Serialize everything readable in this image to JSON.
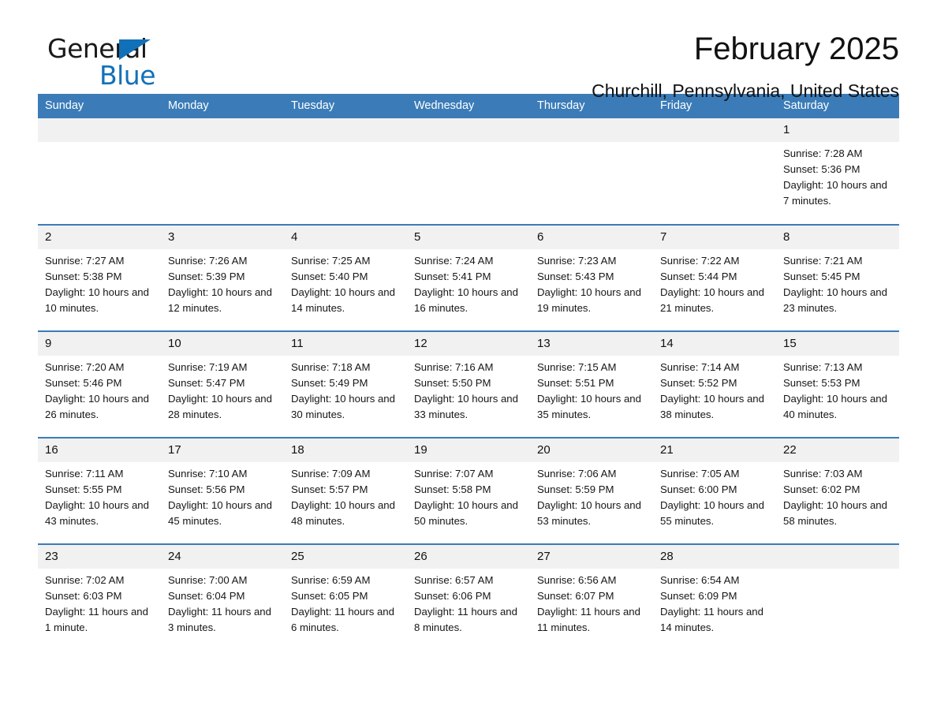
{
  "logo": {
    "text_top": "General",
    "text_bottom": "Blue",
    "triangle_icon": "triangle-icon",
    "accent_color": "#1171b8"
  },
  "header": {
    "title": "February 2025",
    "subtitle": "Churchill, Pennsylvania, United States"
  },
  "theme": {
    "header_blue": "#3b7cb8",
    "daynum_bg": "#f1f1f1",
    "text": "#161616"
  },
  "calendar": {
    "weekday_headers": [
      "Sunday",
      "Monday",
      "Tuesday",
      "Wednesday",
      "Thursday",
      "Friday",
      "Saturday"
    ],
    "weeks": [
      [
        {
          "day": "",
          "lines": []
        },
        {
          "day": "",
          "lines": []
        },
        {
          "day": "",
          "lines": []
        },
        {
          "day": "",
          "lines": []
        },
        {
          "day": "",
          "lines": []
        },
        {
          "day": "",
          "lines": []
        },
        {
          "day": "1",
          "lines": [
            "Sunrise: 7:28 AM",
            "Sunset: 5:36 PM",
            "Daylight: 10 hours and 7 minutes."
          ]
        }
      ],
      [
        {
          "day": "2",
          "lines": [
            "Sunrise: 7:27 AM",
            "Sunset: 5:38 PM",
            "Daylight: 10 hours and 10 minutes."
          ]
        },
        {
          "day": "3",
          "lines": [
            "Sunrise: 7:26 AM",
            "Sunset: 5:39 PM",
            "Daylight: 10 hours and 12 minutes."
          ]
        },
        {
          "day": "4",
          "lines": [
            "Sunrise: 7:25 AM",
            "Sunset: 5:40 PM",
            "Daylight: 10 hours and 14 minutes."
          ]
        },
        {
          "day": "5",
          "lines": [
            "Sunrise: 7:24 AM",
            "Sunset: 5:41 PM",
            "Daylight: 10 hours and 16 minutes."
          ]
        },
        {
          "day": "6",
          "lines": [
            "Sunrise: 7:23 AM",
            "Sunset: 5:43 PM",
            "Daylight: 10 hours and 19 minutes."
          ]
        },
        {
          "day": "7",
          "lines": [
            "Sunrise: 7:22 AM",
            "Sunset: 5:44 PM",
            "Daylight: 10 hours and 21 minutes."
          ]
        },
        {
          "day": "8",
          "lines": [
            "Sunrise: 7:21 AM",
            "Sunset: 5:45 PM",
            "Daylight: 10 hours and 23 minutes."
          ]
        }
      ],
      [
        {
          "day": "9",
          "lines": [
            "Sunrise: 7:20 AM",
            "Sunset: 5:46 PM",
            "Daylight: 10 hours and 26 minutes."
          ]
        },
        {
          "day": "10",
          "lines": [
            "Sunrise: 7:19 AM",
            "Sunset: 5:47 PM",
            "Daylight: 10 hours and 28 minutes."
          ]
        },
        {
          "day": "11",
          "lines": [
            "Sunrise: 7:18 AM",
            "Sunset: 5:49 PM",
            "Daylight: 10 hours and 30 minutes."
          ]
        },
        {
          "day": "12",
          "lines": [
            "Sunrise: 7:16 AM",
            "Sunset: 5:50 PM",
            "Daylight: 10 hours and 33 minutes."
          ]
        },
        {
          "day": "13",
          "lines": [
            "Sunrise: 7:15 AM",
            "Sunset: 5:51 PM",
            "Daylight: 10 hours and 35 minutes."
          ]
        },
        {
          "day": "14",
          "lines": [
            "Sunrise: 7:14 AM",
            "Sunset: 5:52 PM",
            "Daylight: 10 hours and 38 minutes."
          ]
        },
        {
          "day": "15",
          "lines": [
            "Sunrise: 7:13 AM",
            "Sunset: 5:53 PM",
            "Daylight: 10 hours and 40 minutes."
          ]
        }
      ],
      [
        {
          "day": "16",
          "lines": [
            "Sunrise: 7:11 AM",
            "Sunset: 5:55 PM",
            "Daylight: 10 hours and 43 minutes."
          ]
        },
        {
          "day": "17",
          "lines": [
            "Sunrise: 7:10 AM",
            "Sunset: 5:56 PM",
            "Daylight: 10 hours and 45 minutes."
          ]
        },
        {
          "day": "18",
          "lines": [
            "Sunrise: 7:09 AM",
            "Sunset: 5:57 PM",
            "Daylight: 10 hours and 48 minutes."
          ]
        },
        {
          "day": "19",
          "lines": [
            "Sunrise: 7:07 AM",
            "Sunset: 5:58 PM",
            "Daylight: 10 hours and 50 minutes."
          ]
        },
        {
          "day": "20",
          "lines": [
            "Sunrise: 7:06 AM",
            "Sunset: 5:59 PM",
            "Daylight: 10 hours and 53 minutes."
          ]
        },
        {
          "day": "21",
          "lines": [
            "Sunrise: 7:05 AM",
            "Sunset: 6:00 PM",
            "Daylight: 10 hours and 55 minutes."
          ]
        },
        {
          "day": "22",
          "lines": [
            "Sunrise: 7:03 AM",
            "Sunset: 6:02 PM",
            "Daylight: 10 hours and 58 minutes."
          ]
        }
      ],
      [
        {
          "day": "23",
          "lines": [
            "Sunrise: 7:02 AM",
            "Sunset: 6:03 PM",
            "Daylight: 11 hours and 1 minute."
          ]
        },
        {
          "day": "24",
          "lines": [
            "Sunrise: 7:00 AM",
            "Sunset: 6:04 PM",
            "Daylight: 11 hours and 3 minutes."
          ]
        },
        {
          "day": "25",
          "lines": [
            "Sunrise: 6:59 AM",
            "Sunset: 6:05 PM",
            "Daylight: 11 hours and 6 minutes."
          ]
        },
        {
          "day": "26",
          "lines": [
            "Sunrise: 6:57 AM",
            "Sunset: 6:06 PM",
            "Daylight: 11 hours and 8 minutes."
          ]
        },
        {
          "day": "27",
          "lines": [
            "Sunrise: 6:56 AM",
            "Sunset: 6:07 PM",
            "Daylight: 11 hours and 11 minutes."
          ]
        },
        {
          "day": "28",
          "lines": [
            "Sunrise: 6:54 AM",
            "Sunset: 6:09 PM",
            "Daylight: 11 hours and 14 minutes."
          ]
        },
        {
          "day": "",
          "lines": []
        }
      ]
    ]
  }
}
